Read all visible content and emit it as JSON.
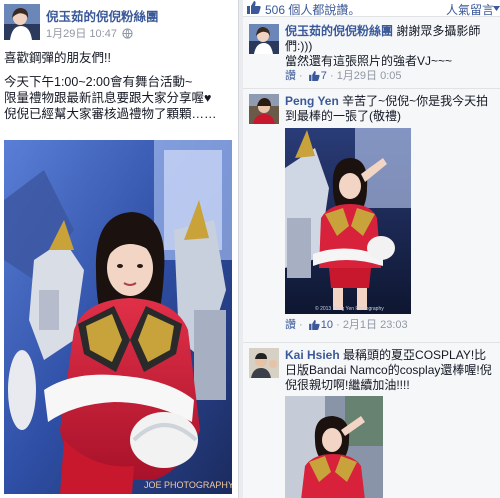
{
  "post": {
    "page_name": "倪玉茹的倪倪粉絲團",
    "timestamp": "1月29日 10:47",
    "privacy_icon": "globe-icon",
    "text_lines": [
      "喜歡鋼彈的朋友們!!",
      "",
      "今天下午1:00~2:00會有舞台活動~",
      "限量禮物跟最新訊息要跟大家分享喔♥",
      "倪倪已經幫大家審核過禮物了顆顆……"
    ],
    "photo_watermark": "JOE PHOTOGRAPHY"
  },
  "likes_bar": {
    "count_text": "506 個人都說讚。",
    "latest_label": "人氣留言"
  },
  "comments": [
    {
      "author": "倪玉茹的倪倪粉絲團",
      "text_lines": [
        "謝謝眾多攝影師",
        "們:)))",
        "當然還有這張照片的強者VJ~~~"
      ],
      "meta": {
        "like_label": "讚",
        "like_count": "7",
        "time": "1月29日 0:05"
      }
    },
    {
      "author": "Peng Yen",
      "text_lines": [
        "辛苦了~倪倪~你是我今天拍",
        "到最棒的一張了(敬禮)"
      ],
      "photo_watermark": "© 2013 Peng Yen Photography",
      "meta": {
        "like_label": "讚",
        "like_count": "10",
        "time": "2月1日 23:03"
      }
    },
    {
      "author": "Kai Hsieh",
      "text_lines": [
        "最稱頭的夏亞COSPLAY!比",
        "日版Bandai Namco的cosplay還棒喔!倪",
        "倪很親切啊!繼續加油!!!!"
      ]
    }
  ],
  "colors": {
    "link_blue": "#3b5998",
    "meta_gray": "#9197a3",
    "costume_red": "#d8213a",
    "costume_gold": "#c8a23a"
  }
}
